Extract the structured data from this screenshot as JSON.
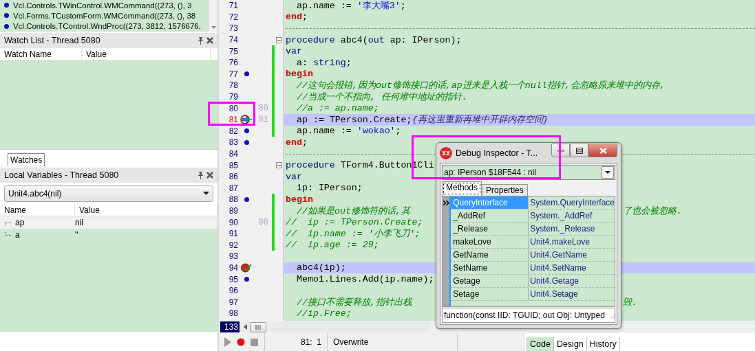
{
  "call_stack": {
    "frames": [
      {
        "text": "Vcl.Controls.TWinControl.WMCommand((273, (), 3"
      },
      {
        "text": "Vcl.Forms.TCustomForm.WMCommand((273, (), 38"
      },
      {
        "text": "Vcl.Controls.TControl.WndProc((273, 3812, 1576676,"
      }
    ]
  },
  "watch_list": {
    "title": "Watch List - Thread 5080",
    "columns": [
      "Watch Name",
      "Value"
    ],
    "tabs": [
      {
        "label": "Watches",
        "selected": true
      }
    ]
  },
  "local_variables": {
    "title": "Local Variables - Thread 5080",
    "scope": "Unit4.abc4(nil)",
    "columns": [
      "Name",
      "Value"
    ],
    "rows": [
      {
        "name": "ap",
        "value": "nil",
        "selected": true
      },
      {
        "name": "a",
        "value": "''",
        "selected": false
      }
    ]
  },
  "editor": {
    "lines": [
      {
        "number": "71",
        "segments": [
          {
            "kind": "plain",
            "text": "  ap.name := "
          },
          {
            "kind": "string",
            "text": "'李大嘴3'"
          },
          {
            "kind": "plain",
            "text": ";"
          }
        ]
      },
      {
        "number": "72",
        "segments": [
          {
            "kind": "block",
            "text": "end"
          },
          {
            "kind": "plain",
            "text": ";"
          }
        ]
      },
      {
        "number": "73",
        "separator": true
      },
      {
        "number": "74",
        "foldable": true,
        "segments": [
          {
            "kind": "keyword",
            "text": "procedure"
          },
          {
            "kind": "plain",
            "text": " abc4("
          },
          {
            "kind": "keyword",
            "text": "out"
          },
          {
            "kind": "plain",
            "text": " ap: IPerson);"
          }
        ]
      },
      {
        "number": "75",
        "modified": true,
        "segments": [
          {
            "kind": "keyword",
            "text": "var"
          }
        ]
      },
      {
        "number": "76",
        "modified": true,
        "segments": [
          {
            "kind": "plain",
            "text": "  a: "
          },
          {
            "kind": "keyword",
            "text": "string"
          },
          {
            "kind": "plain",
            "text": ";"
          }
        ]
      },
      {
        "number": "77",
        "modified": true,
        "marker": {
          "kind": "dot"
        },
        "segments": [
          {
            "kind": "block",
            "text": "begin"
          }
        ]
      },
      {
        "number": "78",
        "modified": true,
        "segments": [
          {
            "kind": "comment",
            "text": "  //这句会报错,因为out修饰接口的话,ap进来是入栈一个null指针,会忽略原来堆中的内存,"
          }
        ]
      },
      {
        "number": "79",
        "modified": true,
        "segments": [
          {
            "kind": "comment",
            "text": "  //当成一个不指向, 任何堆中地址的指针."
          }
        ]
      },
      {
        "number": "80",
        "aux": "80",
        "modified": true,
        "segments": [
          {
            "kind": "comment",
            "text": "  //a := ap.name;"
          }
        ]
      },
      {
        "number": "81",
        "aux": "81",
        "modified": true,
        "current": true,
        "highlight": true,
        "marker": {
          "kind": "exec"
        },
        "segments": [
          {
            "kind": "plain",
            "text": "  ap := TPerson.Create;"
          },
          {
            "kind": "brace_comment",
            "text": "{再这里重新再堆中开辟内存空间}"
          }
        ]
      },
      {
        "number": "82",
        "modified": true,
        "marker": {
          "kind": "dot"
        },
        "segments": [
          {
            "kind": "plain",
            "text": "  ap.name := "
          },
          {
            "kind": "string",
            "text": "'wokao'"
          },
          {
            "kind": "plain",
            "text": ";"
          }
        ]
      },
      {
        "number": "83",
        "marker": {
          "kind": "dot"
        },
        "segments": [
          {
            "kind": "block",
            "text": "end"
          },
          {
            "kind": "plain",
            "text": ";"
          }
        ]
      },
      {
        "number": "84",
        "separator": true
      },
      {
        "number": "85",
        "foldable": true,
        "segments": [
          {
            "kind": "keyword",
            "text": "procedure"
          },
          {
            "kind": "plain",
            "text": " TForm4.Button1Cli"
          }
        ]
      },
      {
        "number": "86",
        "segments": [
          {
            "kind": "keyword",
            "text": "var"
          }
        ]
      },
      {
        "number": "87",
        "segments": [
          {
            "kind": "plain",
            "text": "  ip: IPerson;"
          }
        ]
      },
      {
        "number": "88",
        "modified": true,
        "marker": {
          "kind": "dot"
        },
        "segments": [
          {
            "kind": "block",
            "text": "begin"
          }
        ]
      },
      {
        "number": "89",
        "modified": true,
        "segments": [
          {
            "kind": "comment",
            "text": "  //如果是out修饰符的话,其"
          }
        ],
        "tail": "了也会被忽略."
      },
      {
        "number": "90",
        "aux": "90",
        "modified": true,
        "segments": [
          {
            "kind": "comment",
            "text": "//  ip := TPerson.Create;"
          }
        ]
      },
      {
        "number": "91",
        "modified": true,
        "segments": [
          {
            "kind": "comment",
            "text": "//  ip.name := '小李飞刀';"
          }
        ]
      },
      {
        "number": "92",
        "modified": true,
        "segments": [
          {
            "kind": "comment",
            "text": "//  ip.age := 29;"
          }
        ]
      },
      {
        "number": "93"
      },
      {
        "number": "94",
        "highlight": true,
        "marker": {
          "kind": "breakpoint"
        },
        "segments": [
          {
            "kind": "plain",
            "text": "  abc4(ip);"
          }
        ]
      },
      {
        "number": "95",
        "marker": {
          "kind": "dot"
        },
        "segments": [
          {
            "kind": "plain",
            "text": "  Memo1.Lines.Add(ip.name);"
          }
        ]
      },
      {
        "number": "96"
      },
      {
        "number": "97",
        "segments": [
          {
            "kind": "comment",
            "text": "  //接口不需要释放,指针出栈"
          }
        ],
        "tail": "毁."
      },
      {
        "number": "98",
        "segments": [
          {
            "kind": "comment",
            "text": "  //ip.Free;"
          }
        ]
      }
    ],
    "line_count": "133",
    "position": "81:  1",
    "mode": "Overwrite",
    "view_tabs": [
      {
        "label": "Code",
        "selected": true
      },
      {
        "label": "Design",
        "selected": false
      },
      {
        "label": "History",
        "selected": false
      }
    ]
  },
  "debug_inspector": {
    "title": "Debug Inspector - T...",
    "expression": "ap: IPerson $18F544 : nil",
    "tabs": [
      {
        "label": "Methods",
        "selected": true
      },
      {
        "label": "Properties",
        "selected": false
      }
    ],
    "methods": [
      {
        "name": "QueryInterface",
        "value": "System.QueryInterface",
        "selected": true
      },
      {
        "name": "_AddRef",
        "value": "System._AddRef",
        "selected": false
      },
      {
        "name": "_Release",
        "value": "System._Release",
        "selected": false
      },
      {
        "name": "makeLove",
        "value": "Unit4.makeLove",
        "selected": false
      },
      {
        "name": "GetName",
        "value": "Unit4.GetName",
        "selected": false
      },
      {
        "name": "SetName",
        "value": "Unit4.SetName",
        "selected": false
      },
      {
        "name": "Getage",
        "value": "Unit4.Getage",
        "selected": false
      },
      {
        "name": "Setage",
        "value": "Unit4.Setage",
        "selected": false
      }
    ],
    "hint": "function(const IID: TGUID; out Obj: Untyped"
  }
}
